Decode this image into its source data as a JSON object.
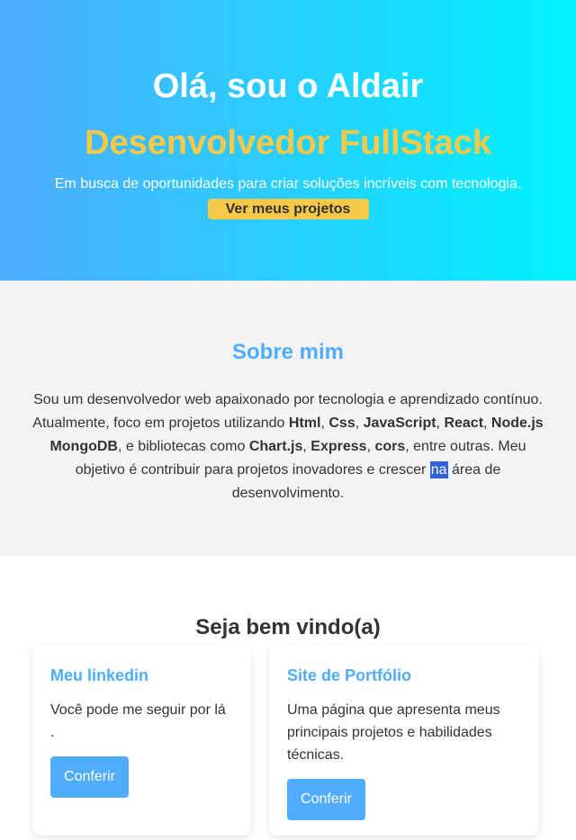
{
  "hero": {
    "title": "Olá, sou o Aldair",
    "subtitle": "Desenvolvedor FullStack",
    "tagline": "Em busca de oportunidades para criar soluções incríveis com tecnologia.",
    "cta_label": "Ver meus projetos"
  },
  "about": {
    "heading": "Sobre mim",
    "text_1": "Sou um desenvolvedor web apaixonado por tecnologia e aprendizado contínuo. Atualmente, foco em projetos utilizando ",
    "tech_1": "Html",
    "sep_1": ", ",
    "tech_2": "Css",
    "sep_2": ", ",
    "tech_3": "JavaScript",
    "sep_3": ", ",
    "tech_4": "React",
    "sep_4": ", ",
    "tech_5": "Node.js",
    "sep_5": " ",
    "tech_6": "MongoDB",
    "text_2": ", e bibliotecas como ",
    "lib_1": "Chart.js",
    "sep_6": ", ",
    "lib_2": "Express",
    "sep_7": ", ",
    "lib_3": "cors",
    "text_3": ", entre outras. Meu objetivo é contribuir para projetos inovadores e crescer ",
    "highlight": "na",
    "text_4": " área de desenvolvimento."
  },
  "welcome": {
    "heading": "Seja bem vindo(a)",
    "cards": [
      {
        "title": "Meu linkedin",
        "description": "Você pode me seguir por lá .",
        "button": "Conferir"
      },
      {
        "title": "Site de Portfólio",
        "description": "Uma página que apresenta meus principais projetos e habilidades técnicas.",
        "button": "Conferir"
      }
    ]
  },
  "colors": {
    "gradient_start": "#4facfe",
    "gradient_end": "#00f2fe",
    "accent_yellow": "#f7c948",
    "accent_blue": "#4facfe",
    "section_gray": "#f3f3f3"
  }
}
